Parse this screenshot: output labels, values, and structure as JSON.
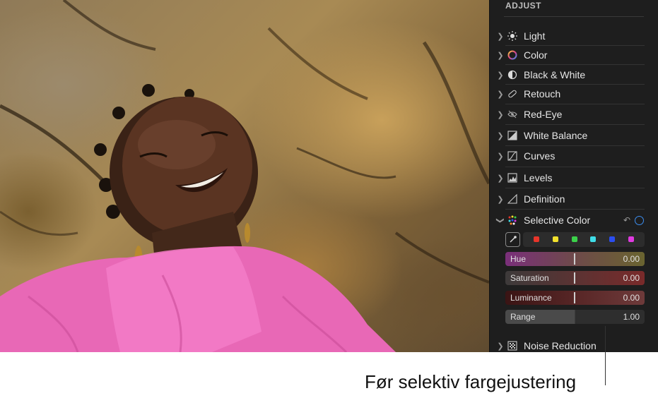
{
  "panel": {
    "title": "ADJUST",
    "items": [
      {
        "label": "Light",
        "icon": "sun-icon"
      },
      {
        "label": "Color",
        "icon": "color-wheel-icon"
      },
      {
        "label": "Black & White",
        "icon": "half-circle-icon"
      },
      {
        "label": "Retouch",
        "icon": "bandage-icon"
      },
      {
        "label": "Red-Eye",
        "icon": "eye-icon"
      },
      {
        "label": "White Balance",
        "icon": "white-balance-icon"
      },
      {
        "label": "Curves",
        "icon": "curves-icon"
      },
      {
        "label": "Levels",
        "icon": "levels-icon"
      },
      {
        "label": "Definition",
        "icon": "triangle-icon"
      },
      {
        "label": "Selective Color",
        "icon": "dots-icon"
      }
    ],
    "selective_color": {
      "swatches": [
        "#e8352a",
        "#f2e12c",
        "#3bd14a",
        "#3fdde8",
        "#2b4ef0",
        "#e03ae0"
      ],
      "sliders": [
        {
          "label": "Hue",
          "value": "0.00"
        },
        {
          "label": "Saturation",
          "value": "0.00"
        },
        {
          "label": "Luminance",
          "value": "0.00"
        },
        {
          "label": "Range",
          "value": "1.00"
        }
      ]
    },
    "bottom_item": {
      "label": "Noise Reduction",
      "icon": "noise-icon"
    }
  },
  "caption": "Før selektiv fargejustering",
  "colors": {
    "accent": "#3c8ef0",
    "panel_bg": "#1e1e1e"
  }
}
